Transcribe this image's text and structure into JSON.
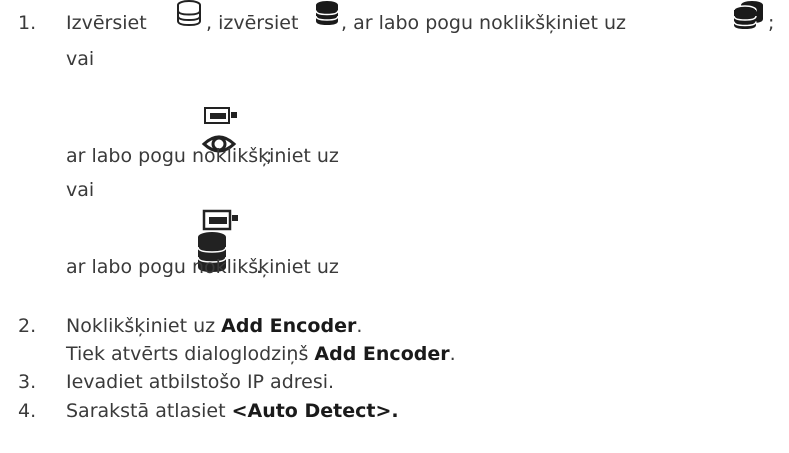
{
  "steps": {
    "s1": {
      "num": "1.",
      "t1": "Izvērsiet",
      "t2": ", izvērsiet",
      "t3": ", ar labo pogu noklikšķiniet uz",
      "t4": ";",
      "or1": "vai",
      "line2": "ar labo pogu noklikšķiniet uz",
      "semi2": ";",
      "or2": "vai",
      "line3": "ar labo pogu noklikšķiniet uz",
      "dot3": "."
    },
    "s2": {
      "num": "2.",
      "pre": "Noklikšķiniet uz ",
      "bold": "Add Encoder",
      "post": ".",
      "sub_pre": "Tiek atvērts dialoglodziņš ",
      "sub_bold": "Add Encoder",
      "sub_post": "."
    },
    "s3": {
      "num": "3.",
      "text": "Ievadiet atbilstošo IP adresi."
    },
    "s4": {
      "num": "4.",
      "pre": "Sarakstā atlasiet ",
      "bold": "<Auto Detect>."
    }
  },
  "icons": {
    "i1": "database-outline-icon",
    "i2": "database-filled-icon",
    "i3": "database-pair-icon",
    "i4": "encoder-eye-icon",
    "i5": "encoder-database-icon"
  }
}
